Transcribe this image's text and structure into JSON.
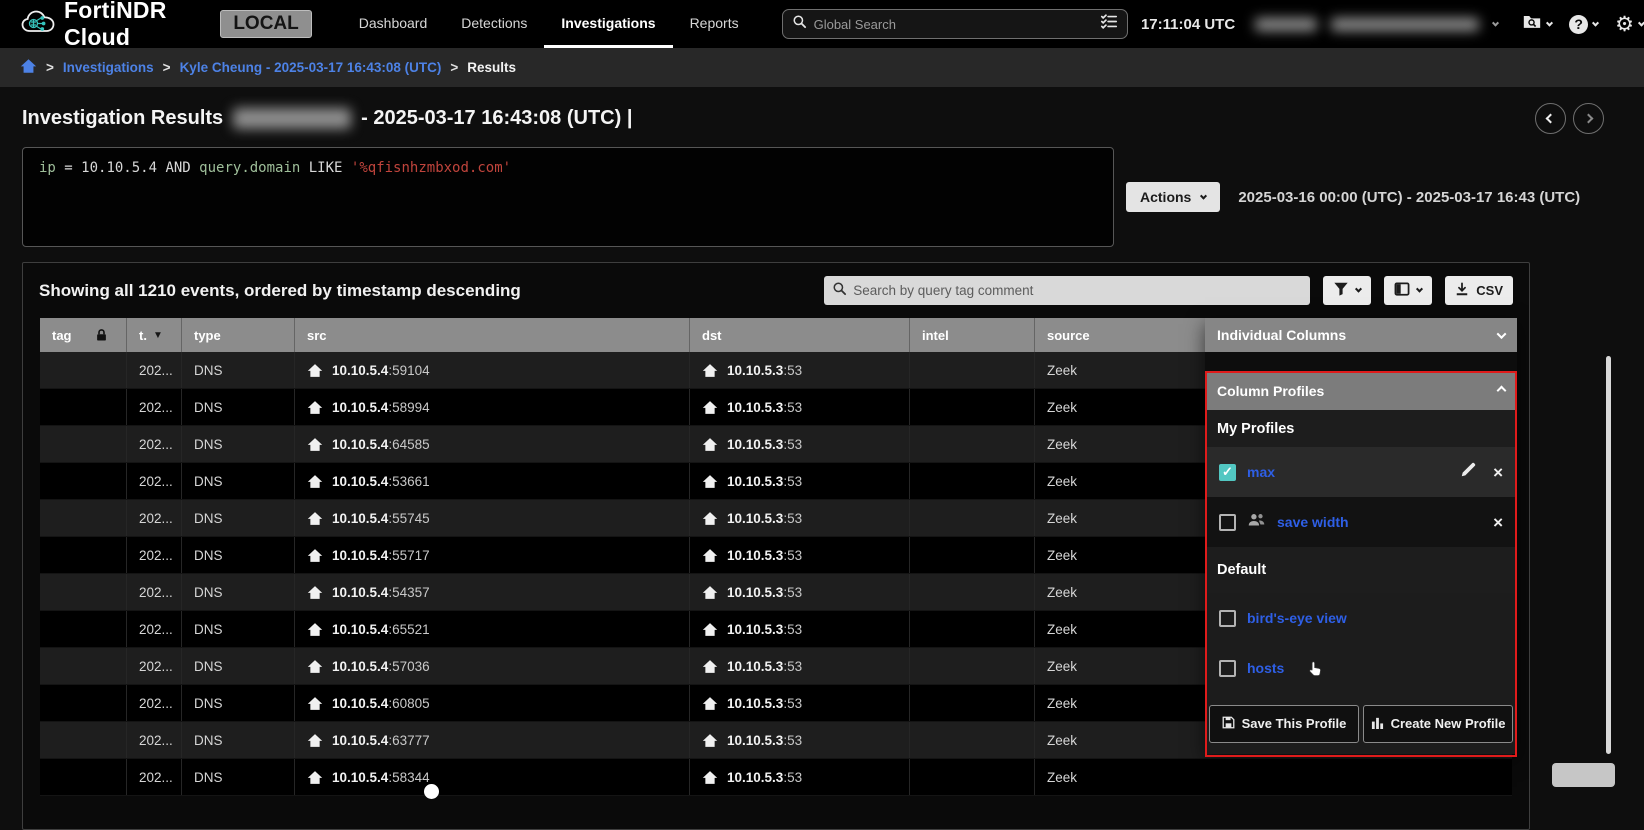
{
  "topbar": {
    "brand": "FortiNDR Cloud",
    "badge": "LOCAL",
    "nav": [
      {
        "label": "Dashboard",
        "active": false
      },
      {
        "label": "Detections",
        "active": false
      },
      {
        "label": "Investigations",
        "active": true
      },
      {
        "label": "Reports",
        "active": false
      }
    ],
    "search_placeholder": "Global Search",
    "clock": "17:11:04 UTC"
  },
  "breadcrumb": {
    "separator": ">",
    "items": [
      "Investigations",
      "Kyle Cheung - 2025-03-17 16:43:08 (UTC)",
      "Results"
    ]
  },
  "title": {
    "prefix": "Investigation Results",
    "suffix": "- 2025-03-17 16:43:08 (UTC) |"
  },
  "query": {
    "tokens": [
      {
        "text": "ip",
        "kind": "field"
      },
      {
        "text": " = ",
        "kind": "op"
      },
      {
        "text": "10.10.5.4",
        "kind": "plain"
      },
      {
        "text": " AND ",
        "kind": "op"
      },
      {
        "text": "query.domain",
        "kind": "field"
      },
      {
        "text": " LIKE ",
        "kind": "op"
      },
      {
        "text": "'%qfisnhzmbxod.com'",
        "kind": "string"
      }
    ]
  },
  "controls": {
    "actions_label": "Actions",
    "date_range": "2025-03-16 00:00 (UTC) - 2025-03-17 16:43 (UTC)"
  },
  "results": {
    "summary": "Showing all 1210 events, ordered by timestamp descending",
    "search_placeholder": "Search by query tag comment",
    "csv_label": "CSV"
  },
  "table": {
    "columns": {
      "tag": "tag",
      "t": "t.",
      "type": "type",
      "src": "src",
      "dst": "dst",
      "intel": "intel",
      "source": "source"
    },
    "sort_indicator": "▼",
    "rows": [
      {
        "t": "202...",
        "type": "DNS",
        "src_ip": "10.10.5.4",
        "src_port": ":59104",
        "dst_ip": "10.10.5.3",
        "dst_port": ":53",
        "intel": "",
        "source": "Zeek"
      },
      {
        "t": "202...",
        "type": "DNS",
        "src_ip": "10.10.5.4",
        "src_port": ":58994",
        "dst_ip": "10.10.5.3",
        "dst_port": ":53",
        "intel": "",
        "source": "Zeek"
      },
      {
        "t": "202...",
        "type": "DNS",
        "src_ip": "10.10.5.4",
        "src_port": ":64585",
        "dst_ip": "10.10.5.3",
        "dst_port": ":53",
        "intel": "",
        "source": "Zeek"
      },
      {
        "t": "202...",
        "type": "DNS",
        "src_ip": "10.10.5.4",
        "src_port": ":53661",
        "dst_ip": "10.10.5.3",
        "dst_port": ":53",
        "intel": "",
        "source": "Zeek"
      },
      {
        "t": "202...",
        "type": "DNS",
        "src_ip": "10.10.5.4",
        "src_port": ":55745",
        "dst_ip": "10.10.5.3",
        "dst_port": ":53",
        "intel": "",
        "source": "Zeek"
      },
      {
        "t": "202...",
        "type": "DNS",
        "src_ip": "10.10.5.4",
        "src_port": ":55717",
        "dst_ip": "10.10.5.3",
        "dst_port": ":53",
        "intel": "",
        "source": "Zeek"
      },
      {
        "t": "202...",
        "type": "DNS",
        "src_ip": "10.10.5.4",
        "src_port": ":54357",
        "dst_ip": "10.10.5.3",
        "dst_port": ":53",
        "intel": "",
        "source": "Zeek"
      },
      {
        "t": "202...",
        "type": "DNS",
        "src_ip": "10.10.5.4",
        "src_port": ":65521",
        "dst_ip": "10.10.5.3",
        "dst_port": ":53",
        "intel": "",
        "source": "Zeek"
      },
      {
        "t": "202...",
        "type": "DNS",
        "src_ip": "10.10.5.4",
        "src_port": ":57036",
        "dst_ip": "10.10.5.3",
        "dst_port": ":53",
        "intel": "",
        "source": "Zeek"
      },
      {
        "t": "202...",
        "type": "DNS",
        "src_ip": "10.10.5.4",
        "src_port": ":60805",
        "dst_ip": "10.10.5.3",
        "dst_port": ":53",
        "intel": "",
        "source": "Zeek"
      },
      {
        "t": "202...",
        "type": "DNS",
        "src_ip": "10.10.5.4",
        "src_port": ":63777",
        "dst_ip": "10.10.5.3",
        "dst_port": ":53",
        "intel": "",
        "source": "Zeek"
      },
      {
        "t": "202...",
        "type": "DNS",
        "src_ip": "10.10.5.4",
        "src_port": ":58344",
        "dst_ip": "10.10.5.3",
        "dst_port": ":53",
        "intel": "",
        "source": "Zeek"
      }
    ]
  },
  "columns_panel": {
    "individual_header": "Individual Columns",
    "profiles_header": "Column Profiles",
    "my_profiles_label": "My Profiles",
    "my_profiles": [
      {
        "name": "max",
        "checked": true,
        "shared": false
      },
      {
        "name": "save width",
        "checked": false,
        "shared": true
      }
    ],
    "default_label": "Default",
    "default_profiles": [
      {
        "name": "bird's-eye view",
        "checked": false
      },
      {
        "name": "hosts",
        "checked": false
      }
    ],
    "save_profile_label": "Save This Profile",
    "create_profile_label": "Create New Profile",
    "check_glyph": "✓",
    "remove_glyph": "×"
  },
  "colors": {
    "accent_blue": "#2e5fe6",
    "link_blue": "#4d82e6",
    "teal_check": "#52c7c2",
    "highlight_red": "#e01b1b",
    "query_string_red": "#c0443c",
    "query_field_green": "#9fbf9a",
    "table_header_gray": "#8c8c8c"
  }
}
